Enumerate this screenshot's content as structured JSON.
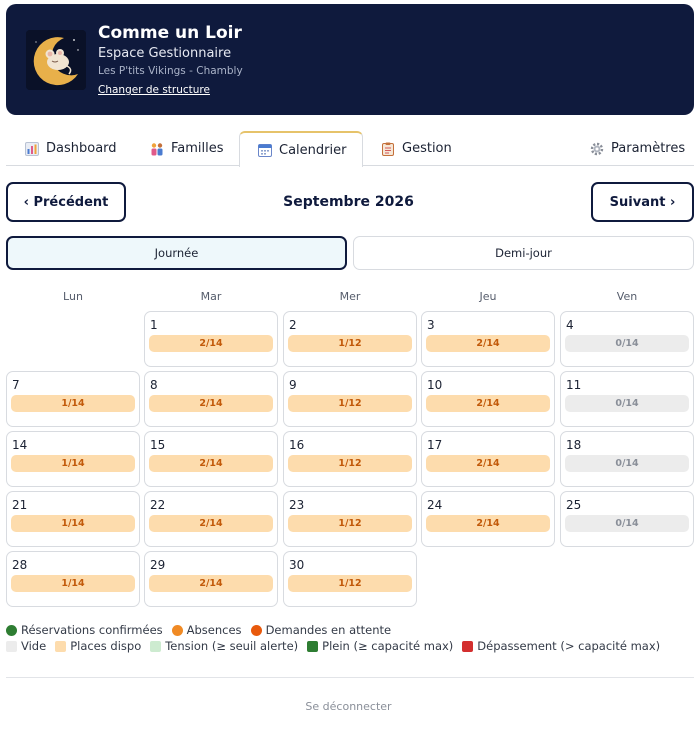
{
  "header": {
    "title": "Comme un Loir",
    "subtitle": "Espace Gestionnaire",
    "structure": "Les P'tits Vikings - Chambly",
    "change_link": "Changer de structure"
  },
  "tabs": [
    {
      "label": "Dashboard",
      "icon": "bar-chart-icon"
    },
    {
      "label": "Familles",
      "icon": "family-icon"
    },
    {
      "label": "Calendrier",
      "icon": "calendar-icon",
      "active": true
    },
    {
      "label": "Gestion",
      "icon": "clipboard-icon"
    },
    {
      "label": "Paramètres",
      "icon": "gear-icon"
    }
  ],
  "nav": {
    "prev": "‹ Précédent",
    "next": "Suivant ›",
    "month": "Septembre 2026"
  },
  "mode": {
    "day": "Journée",
    "half": "Demi-jour",
    "selected": "day"
  },
  "weekdays": [
    "Lun",
    "Mar",
    "Mer",
    "Jeu",
    "Ven"
  ],
  "days": [
    {
      "day": "1",
      "col": 1,
      "row": 0,
      "label": "2/14",
      "status": "dispo"
    },
    {
      "day": "2",
      "col": 2,
      "row": 0,
      "label": "1/12",
      "status": "dispo"
    },
    {
      "day": "3",
      "col": 3,
      "row": 0,
      "label": "2/14",
      "status": "dispo"
    },
    {
      "day": "4",
      "col": 4,
      "row": 0,
      "label": "0/14",
      "status": "vide"
    },
    {
      "day": "7",
      "col": 0,
      "row": 1,
      "label": "1/14",
      "status": "dispo"
    },
    {
      "day": "8",
      "col": 1,
      "row": 1,
      "label": "2/14",
      "status": "dispo"
    },
    {
      "day": "9",
      "col": 2,
      "row": 1,
      "label": "1/12",
      "status": "dispo"
    },
    {
      "day": "10",
      "col": 3,
      "row": 1,
      "label": "2/14",
      "status": "dispo"
    },
    {
      "day": "11",
      "col": 4,
      "row": 1,
      "label": "0/14",
      "status": "vide"
    },
    {
      "day": "14",
      "col": 0,
      "row": 2,
      "label": "1/14",
      "status": "dispo"
    },
    {
      "day": "15",
      "col": 1,
      "row": 2,
      "label": "2/14",
      "status": "dispo"
    },
    {
      "day": "16",
      "col": 2,
      "row": 2,
      "label": "1/12",
      "status": "dispo"
    },
    {
      "day": "17",
      "col": 3,
      "row": 2,
      "label": "2/14",
      "status": "dispo"
    },
    {
      "day": "18",
      "col": 4,
      "row": 2,
      "label": "0/14",
      "status": "vide"
    },
    {
      "day": "21",
      "col": 0,
      "row": 3,
      "label": "1/14",
      "status": "dispo"
    },
    {
      "day": "22",
      "col": 1,
      "row": 3,
      "label": "2/14",
      "status": "dispo"
    },
    {
      "day": "23",
      "col": 2,
      "row": 3,
      "label": "1/12",
      "status": "dispo"
    },
    {
      "day": "24",
      "col": 3,
      "row": 3,
      "label": "2/14",
      "status": "dispo"
    },
    {
      "day": "25",
      "col": 4,
      "row": 3,
      "label": "0/14",
      "status": "vide"
    },
    {
      "day": "28",
      "col": 0,
      "row": 4,
      "label": "1/14",
      "status": "dispo"
    },
    {
      "day": "29",
      "col": 1,
      "row": 4,
      "label": "2/14",
      "status": "dispo"
    },
    {
      "day": "30",
      "col": 2,
      "row": 4,
      "label": "1/12",
      "status": "dispo"
    }
  ],
  "status_colors": {
    "dispo": {
      "bg": "#fddcad",
      "fg": "#c25a0a"
    },
    "vide": {
      "bg": "#ececec",
      "fg": "#8a8f99"
    }
  },
  "legend": {
    "row1": [
      {
        "label": "Réservations confirmées",
        "color": "#2e7d32",
        "shape": "dot"
      },
      {
        "label": "Absences",
        "color": "#f08a24",
        "shape": "dot"
      },
      {
        "label": "Demandes en attente",
        "color": "#e8590c",
        "shape": "dot"
      }
    ],
    "row2": [
      {
        "label": "Vide",
        "color": "#ececec",
        "shape": "square"
      },
      {
        "label": "Places dispo",
        "color": "#fddcad",
        "shape": "square"
      },
      {
        "label": "Tension (≥ seuil alerte)",
        "color": "#cdebd0",
        "shape": "square"
      },
      {
        "label": "Plein (≥ capacité max)",
        "color": "#2e7d32",
        "shape": "square"
      },
      {
        "label": "Dépassement (> capacité max)",
        "color": "#d32f2f",
        "shape": "square"
      }
    ]
  },
  "footer": {
    "logout": "Se déconnecter"
  }
}
